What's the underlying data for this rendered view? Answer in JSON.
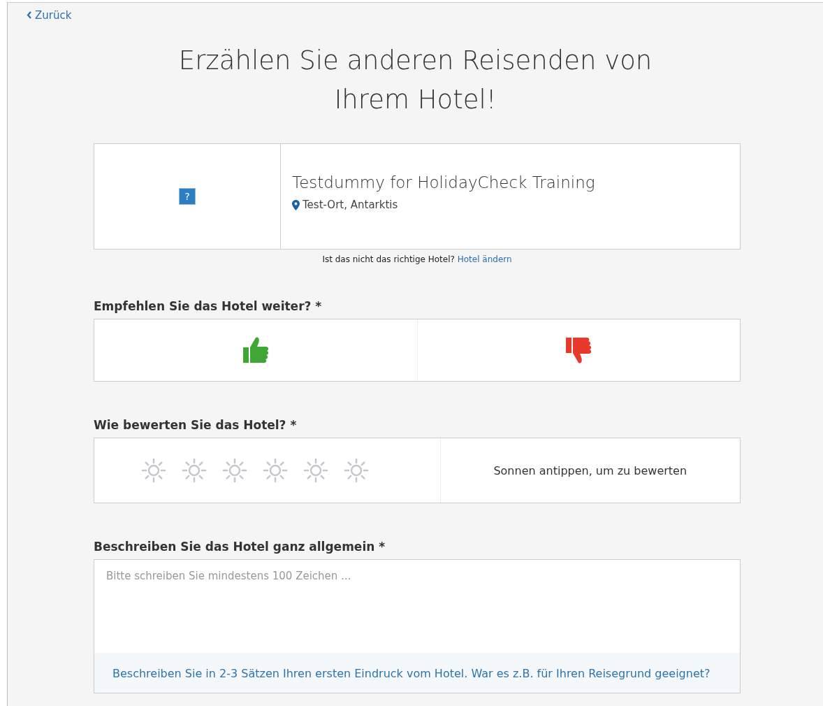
{
  "back_link": {
    "label": "Zurück"
  },
  "title": "Erzählen Sie anderen Reisenden von Ihrem Hotel!",
  "hotel": {
    "image_glyph": "?",
    "name": "Testdummy for HolidayCheck Training",
    "location": "Test-Ort, Antarktis"
  },
  "change_hotel": {
    "question": "Ist das nicht das richtige Hotel?",
    "link": "Hotel ändern"
  },
  "recommend": {
    "label": "Empfehlen Sie das Hotel weiter? *",
    "options": [
      {
        "kind": "up",
        "selected": false
      },
      {
        "kind": "down",
        "selected": false
      }
    ]
  },
  "rating": {
    "label": "Wie bewerten Sie das Hotel? *",
    "stars": 0,
    "hint": "Sonnen antippen, um zu bewerten"
  },
  "description": {
    "label": "Beschreiben Sie das Hotel ganz allgemein *",
    "placeholder": "Bitte schreiben Sie mindestens 100 Zeichen ...",
    "tip": "Beschreiben Sie in 2-3 Sätzen Ihren ersten Eindruck vom Hotel. War es z.B. für Ihren Reisegrund geeignet?"
  }
}
